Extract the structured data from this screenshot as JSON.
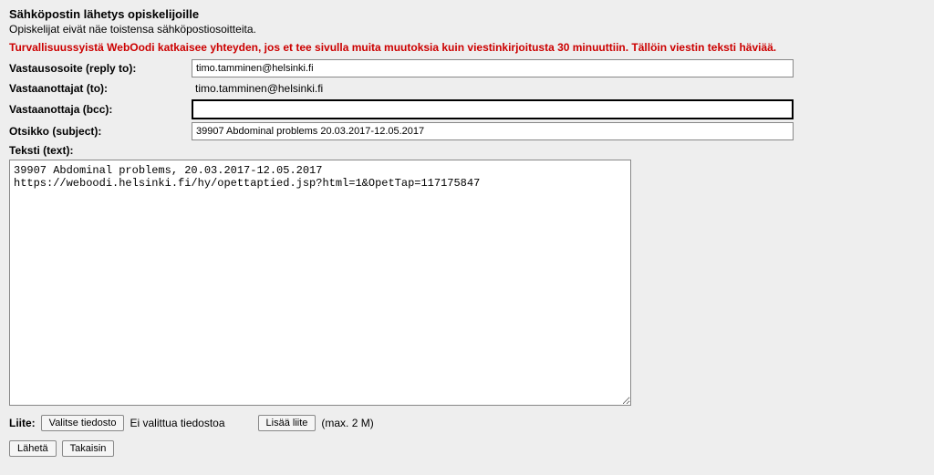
{
  "header": {
    "title": "Sähköpostin lähetys opiskelijoille",
    "subtitle": "Opiskelijat eivät näe toistensa sähköpostiosoitteita."
  },
  "warning": "Turvallisuussyistä WebOodi katkaisee yhteyden, jos et tee sivulla muita muutoksia kuin viestinkirjoitusta 30 minuuttiin. Tällöin viestin teksti häviää.",
  "form": {
    "reply_to_label": "Vastausosoite (reply to):",
    "reply_to_value": "timo.tamminen@helsinki.fi",
    "to_label": "Vastaanottajat (to):",
    "to_value": "timo.tamminen@helsinki.fi",
    "bcc_label": "Vastaanottaja (bcc):",
    "bcc_value": "",
    "subject_label": "Otsikko (subject):",
    "subject_value": "39907 Abdominal problems 20.03.2017-12.05.2017",
    "text_label": "Teksti (text):",
    "text_value": "39907 Abdominal problems, 20.03.2017-12.05.2017\nhttps://weboodi.helsinki.fi/hy/opettaptied.jsp?html=1&OpetTap=117175847"
  },
  "attachment": {
    "label": "Liite:",
    "choose_file": "Valitse tiedosto",
    "no_file": "Ei valittua tiedostoa",
    "add_button": "Lisää liite",
    "max_size": "(max. 2 M)"
  },
  "actions": {
    "send": "Lähetä",
    "back": "Takaisin"
  }
}
